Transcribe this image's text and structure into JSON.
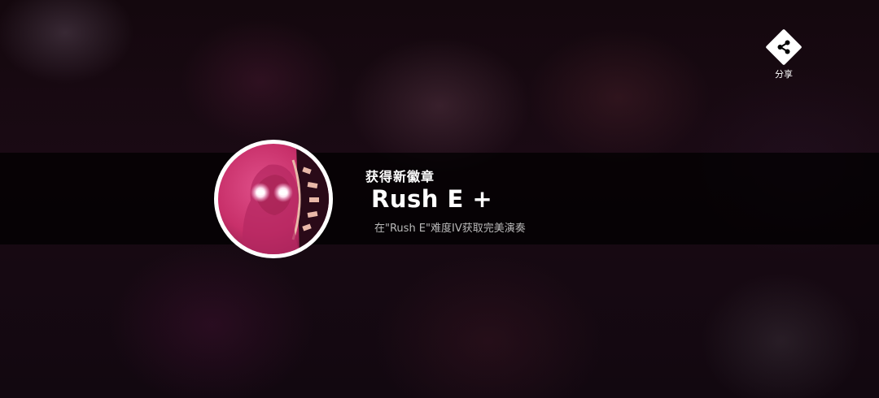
{
  "share": {
    "icon": "share-icon",
    "label": "分享"
  },
  "achievement": {
    "header": "获得新徽章",
    "badge_name": "Rush E +",
    "description": "在\"Rush E\"难度IV获取完美演奏"
  },
  "colors": {
    "badge_pink": "#d23c78",
    "badge_ring": "#ffffff",
    "banner_bg": "#000000",
    "description_text": "#b9b9b9"
  }
}
